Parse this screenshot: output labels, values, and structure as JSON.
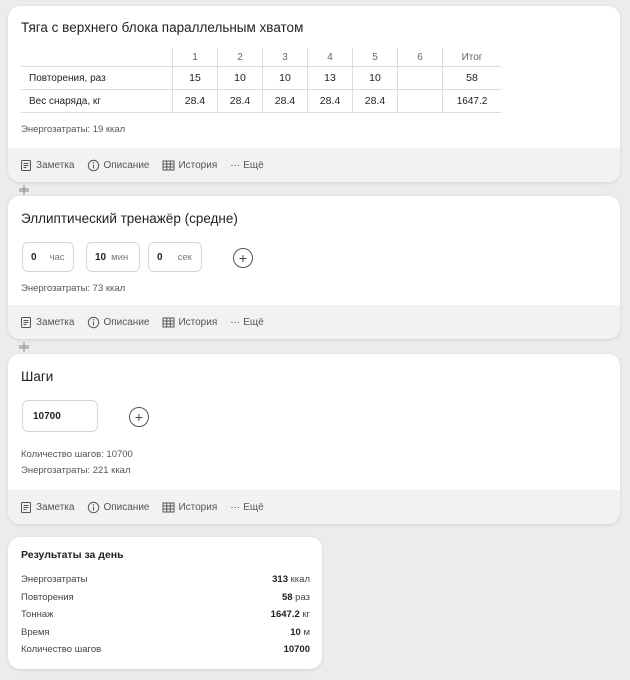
{
  "exercise1": {
    "title": "Тяга с верхнего блока параллельным хватом",
    "columns": [
      "1",
      "2",
      "3",
      "4",
      "5",
      "6",
      "Итог"
    ],
    "rows": [
      {
        "label": "Повторения, раз",
        "values": [
          "15",
          "10",
          "10",
          "13",
          "10",
          "",
          "58"
        ]
      },
      {
        "label": "Вес снаряда, кг",
        "values": [
          "28.4",
          "28.4",
          "28.4",
          "28.4",
          "28.4",
          "",
          "1647.2"
        ]
      }
    ],
    "energy": "Энергозатраты: 19 ккал"
  },
  "exercise2": {
    "title": "Эллиптический тренажёр (средне)",
    "hours_value": "0",
    "hours_unit": "час",
    "minutes_value": "10",
    "minutes_unit": "мин",
    "seconds_value": "0",
    "seconds_unit": "сек",
    "energy": "Энергозатраты: 73 ккал"
  },
  "exercise3": {
    "title": "Шаги",
    "steps_value": "10700",
    "steps_count": "Количество шагов: 10700",
    "energy": "Энергозатраты: 221 ккал"
  },
  "footer": {
    "note": "Заметка",
    "description": "Описание",
    "history": "История",
    "more": "Ещё"
  },
  "summary": {
    "title": "Результаты за день",
    "rows": [
      {
        "label": "Энергозатраты",
        "value": "313",
        "unit": "ккал"
      },
      {
        "label": "Повторения",
        "value": "58",
        "unit": "раз"
      },
      {
        "label": "Тоннаж",
        "value": "1647.2",
        "unit": "кг"
      },
      {
        "label": "Время",
        "value": "10",
        "unit": "м"
      },
      {
        "label": "Количество шагов",
        "value": "10700",
        "unit": ""
      }
    ]
  },
  "icons": {
    "note": "note-icon",
    "description": "info-icon",
    "history": "table-icon",
    "more": "ellipsis-icon",
    "add": "plus-circle-icon",
    "separator": "separator-icon"
  }
}
